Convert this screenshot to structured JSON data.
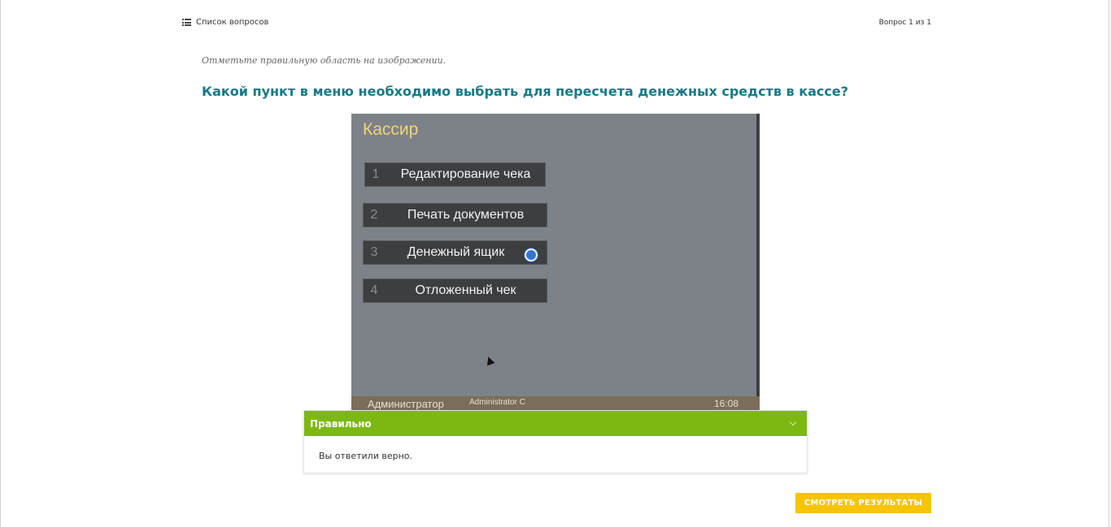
{
  "header": {
    "list_label": "Список вопросов",
    "list_icon": "list-icon",
    "counter": "Вопрос 1 из 1"
  },
  "question": {
    "instruction": "Отметьте правильную область на изображении.",
    "text": "Какой пункт в меню необходимо выбрать для пересчета денежных средств в кассе?"
  },
  "screenshot": {
    "title": "Кассир",
    "menu": [
      {
        "num": "1",
        "label": "Редактирование чека"
      },
      {
        "num": "2",
        "label": "Печать документов"
      },
      {
        "num": "3",
        "label": "Денежный ящик"
      },
      {
        "num": "4",
        "label": "Отложенный чек"
      }
    ],
    "status": {
      "user": "Администратор",
      "login": "Administrator C",
      "time": "16:08"
    }
  },
  "feedback": {
    "title": "Правильно",
    "message": "Вы ответили верно.",
    "color": "#7db812"
  },
  "actions": {
    "results_label": "СМОТРЕТЬ РЕЗУЛЬТАТЫ",
    "results_color": "#f7c400"
  },
  "colors": {
    "question": "#177a86",
    "marker": "#3474d9"
  }
}
